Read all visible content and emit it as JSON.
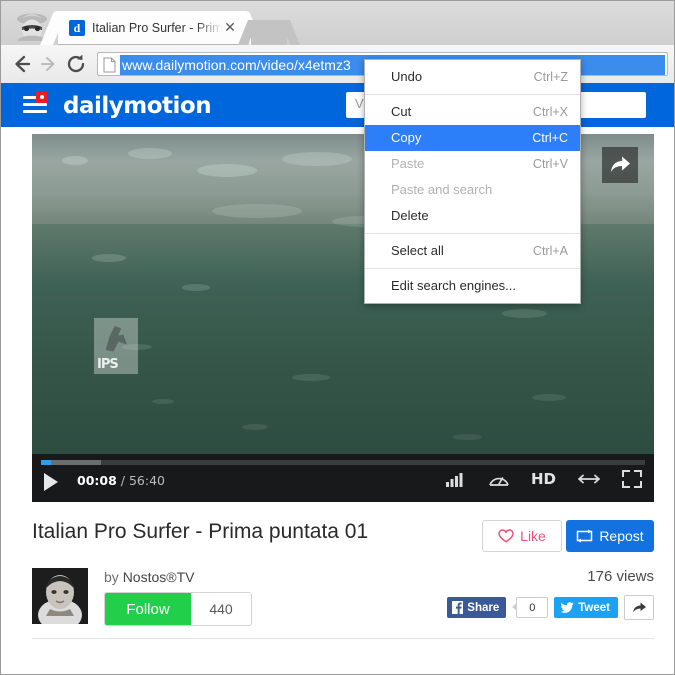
{
  "browser": {
    "tab": {
      "title": "Italian Pro Surfer - Prima p",
      "favicon_letter": "d",
      "close_label": "✕"
    },
    "nav": {
      "back": "back-arrow",
      "forward": "forward-arrow",
      "reload": "reload-icon"
    },
    "omnibox": {
      "url": "www.dailymotion.com/video/x4etmz3"
    },
    "incognito": "incognito-spy-icon"
  },
  "context_menu": {
    "items": [
      {
        "label": "Undo",
        "accel": "Ctrl+Z",
        "state": "normal"
      },
      {
        "label": "Cut",
        "accel": "Ctrl+X",
        "state": "normal"
      },
      {
        "label": "Copy",
        "accel": "Ctrl+C",
        "state": "selected"
      },
      {
        "label": "Paste",
        "accel": "Ctrl+V",
        "state": "disabled"
      },
      {
        "label": "Paste and search",
        "accel": "",
        "state": "disabled"
      },
      {
        "label": "Delete",
        "accel": "",
        "state": "normal"
      },
      {
        "label": "Select all",
        "accel": "Ctrl+A",
        "state": "normal"
      },
      {
        "label": "Edit search engines...",
        "accel": "",
        "state": "normal"
      }
    ]
  },
  "site": {
    "header": {
      "logo": "dailymotion",
      "search_placeholder": "V"
    },
    "player": {
      "current_time": "00:08",
      "separator": " / ",
      "duration": "56:40",
      "quality_label": "HD",
      "progress_played_pct": 1.6,
      "progress_buffered_pct": 10
    },
    "video": {
      "title": "Italian Pro Surfer - Prima puntata 01",
      "watermark": "IPS",
      "like_label": "Like",
      "repost_label": "Repost",
      "author_prefix": "by ",
      "author_name": "Nostos®TV",
      "follow_label": "Follow",
      "follow_count": "440",
      "views": "176 views"
    },
    "social": {
      "facebook_label": "Share",
      "facebook_count": "0",
      "twitter_label": "Tweet"
    }
  },
  "colors": {
    "dm_blue": "#0066dc",
    "repost_blue": "#1272e0",
    "follow_green": "#22cf4b",
    "like_pink": "#f0517a",
    "fb_blue": "#3b5998",
    "tw_blue": "#1da1f2",
    "menu_highlight": "#2d7ff9",
    "url_selection": "#3a8ced"
  }
}
